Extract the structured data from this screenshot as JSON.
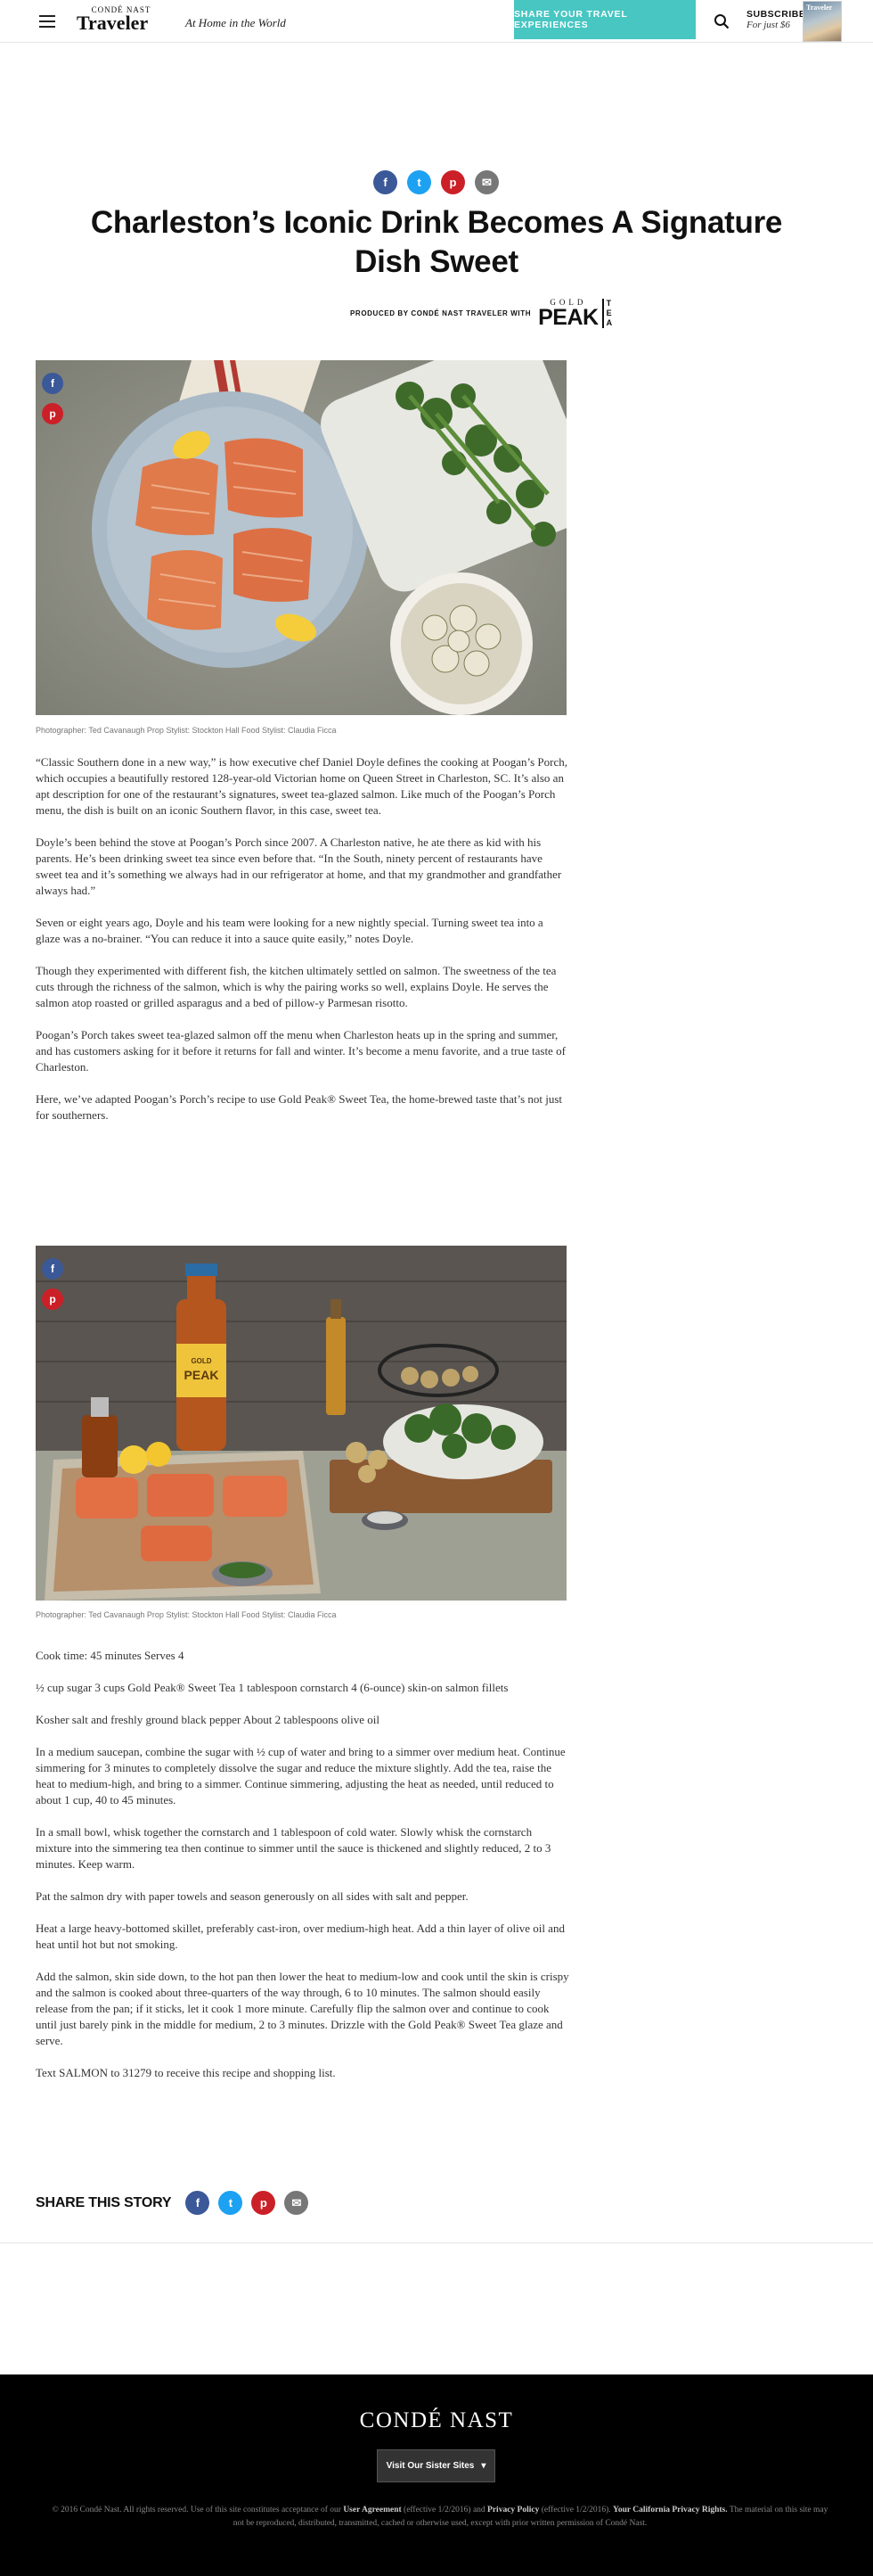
{
  "header": {
    "logo_top": "CONDÉ NAST",
    "logo_main": "Traveler",
    "tagline": "At Home in the World",
    "share_button": "SHARE YOUR TRAVEL EXPERIENCES",
    "subscribe_title": "SUBSCRIBE",
    "subscribe_sub": "For just $6",
    "cover_text": "Traveler"
  },
  "article": {
    "title": "Charleston’s Iconic Drink Becomes A Signature Dish Sweet",
    "produced_by": "PRODUCED BY CONDÉ NAST TRAVELER WITH",
    "sponsor_logo": {
      "gold": "GOLD",
      "peak": "PEAK",
      "tea": [
        "T",
        "E",
        "A"
      ]
    },
    "caption1": "Photographer: Ted Cavanaugh Prop Stylist: Stockton Hall  Food Stylist: Claudia Ficca",
    "paragraphs": [
      "“Classic Southern done in a new way,” is how executive chef Daniel Doyle defines the cooking at Poogan’s Porch, which occupies a beautifully restored 128-year-old Victorian home on Queen Street in Charleston, SC. It’s also an apt description for one of the restaurant’s signatures, sweet tea-glazed salmon. Like much of the Poogan’s Porch menu, the dish is built on an iconic Southern flavor, in this case, sweet tea.",
      "Doyle’s been behind the stove at Poogan’s Porch since 2007. A Charleston native, he ate there as kid with his parents. He’s been drinking sweet tea since even before that. “In the South, ninety percent of restaurants have sweet tea and it’s something we always had in our refrigerator at home, and that my grandmother and grandfather always had.”",
      "Seven or eight years ago, Doyle and his team were looking for a new nightly special. Turning sweet tea into a glaze was a no-brainer. “You can reduce it into a sauce quite easily,” notes Doyle.",
      "Though they experimented with different fish, the kitchen ultimately settled on salmon. The sweetness of the tea cuts through the richness of the salmon, which is why the pairing works so well, explains Doyle. He serves the salmon atop roasted or grilled asparagus and a bed of pillow-y Parmesan risotto.",
      "Poogan’s Porch takes sweet tea-glazed salmon off the menu when Charleston heats up in the spring and summer, and has customers asking for it before it returns for fall and winter. It’s become a menu favorite, and a true taste of Charleston.",
      "Here, we’ve adapted Poogan’s Porch’s recipe to use Gold Peak® Sweet Tea, the home-brewed taste that’s not just for southerners."
    ],
    "caption2": "Photographer: Ted Cavanaugh Prop Stylist: Stockton Hall  Food Stylist: Claudia Ficca",
    "recipe": [
      "Cook time: 45 minutes Serves 4",
      "½ cup sugar 3 cups Gold Peak® Sweet Tea 1 tablespoon cornstarch 4 (6-ounce) skin-on salmon fillets",
      "Kosher salt and freshly ground black pepper About 2 tablespoons olive oil",
      "In a medium saucepan, combine the sugar with ½ cup of water and bring to a simmer over medium heat. Continue simmering for 3 minutes to completely dissolve the sugar and reduce the mixture slightly. Add the tea, raise the heat to medium-high, and bring to a simmer. Continue simmering, adjusting the heat as needed, until reduced to about 1 cup, 40 to 45 minutes.",
      "In a small bowl, whisk together the cornstarch and 1 tablespoon of cold water. Slowly whisk the cornstarch mixture into the simmering tea then continue to simmer until the sauce is thickened and slightly reduced, 2 to 3 minutes. Keep warm.",
      "Pat the salmon dry with paper towels and season generously on all sides with salt and pepper.",
      "Heat a large heavy-bottomed skillet, preferably cast-iron, over medium-high heat. Add a thin layer of olive oil and heat until hot but not smoking.",
      "Add the salmon, skin side down, to the hot pan then lower the heat to medium-low and cook until the skin is crispy and the salmon is cooked about three-quarters of the way through, 6 to 10 minutes. The salmon should easily release from the pan; if it sticks, let it cook 1 more minute. Carefully flip the salmon over and continue to cook until just barely pink in the middle for medium, 2 to 3 minutes. Drizzle with the Gold Peak® Sweet Tea glaze and serve.",
      "Text SALMON to 31279 to receive this recipe and shopping list."
    ],
    "share_story_label": "SHARE THIS STORY",
    "bottle_label": {
      "brand": "GOLD",
      "name": "PEAK"
    }
  },
  "icons": {
    "facebook": "f",
    "twitter": "t",
    "pinterest": "p",
    "email": "✉"
  },
  "footer": {
    "logo": "CONDÉ NAST",
    "sister_sites": "Visit Our Sister Sites",
    "legal_pre": "© 2016 Condé Nast. All rights reserved. Use of this site constitutes acceptance of our",
    "user_agreement": "User Agreement",
    "legal_mid1": "(effective 1/2/2016) and",
    "privacy_policy": "Privacy Policy",
    "legal_mid2": "(effective 1/2/2016).",
    "california": "Your California Privacy Rights.",
    "legal_post": "The material on this site may not be reproduced, distributed, transmitted, cached or otherwise used, except with prior written permission of Condé Nast."
  },
  "colors": {
    "accent": "#48c6c2",
    "facebook": "#3b5998",
    "twitter": "#1da1f2",
    "pinterest": "#cb2027"
  }
}
